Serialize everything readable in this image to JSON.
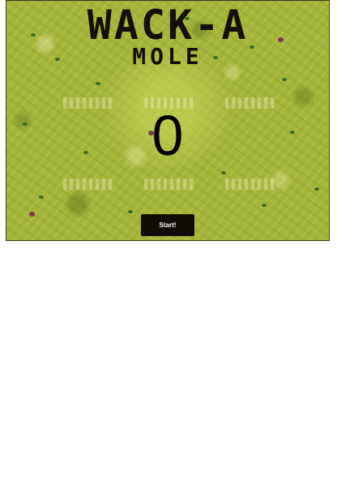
{
  "game": {
    "title_line1": "WACK-A",
    "title_line2": "MOLE",
    "score": "0",
    "start_label": "Start!",
    "hole_count": 6
  },
  "colors": {
    "background": "#a4b63a",
    "title_text": "#141008",
    "button_bg": "#120c06",
    "button_text": "#ffffff"
  }
}
